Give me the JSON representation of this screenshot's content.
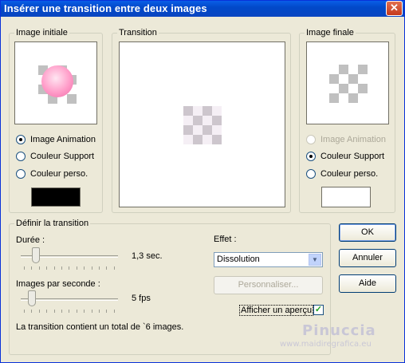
{
  "window": {
    "title": "Insérer une transition entre deux images",
    "close_label": "✕"
  },
  "initial": {
    "group_label": "Image initiale",
    "options": [
      "Image Animation",
      "Couleur Support",
      "Couleur perso."
    ],
    "selected_index": 0,
    "swatch_color": "#000000",
    "preview_icon": "pink-sphere-thumbnail"
  },
  "transition": {
    "group_label": "Transition",
    "preview_icon": "dissolve-thumbnail"
  },
  "final": {
    "group_label": "Image finale",
    "options": [
      "Image Animation",
      "Couleur Support",
      "Couleur perso."
    ],
    "selected_index": 1,
    "disabled_index": 0,
    "swatch_color": "#ffffff",
    "preview_icon": "checkerboard-thumbnail"
  },
  "define": {
    "group_label": "Définir la transition",
    "duration_label": "Durée :",
    "duration_value": "1,3 sec.",
    "duration_level": 0.15,
    "fps_label": "Images par seconde :",
    "fps_value": "5 fps",
    "fps_level": 0.1,
    "summary": "La transition contient un total de `6  images.",
    "effect_label": "Effet :",
    "effect_value": "Dissolution",
    "customize_label": "Personnaliser...",
    "preview_label": "Afficher un aperçu",
    "preview_checked": true
  },
  "buttons": {
    "ok": "OK",
    "cancel": "Annuler",
    "help": "Aide"
  },
  "watermark": {
    "name": "Pinuccia",
    "url": "www.maidiregrafica.eu"
  }
}
